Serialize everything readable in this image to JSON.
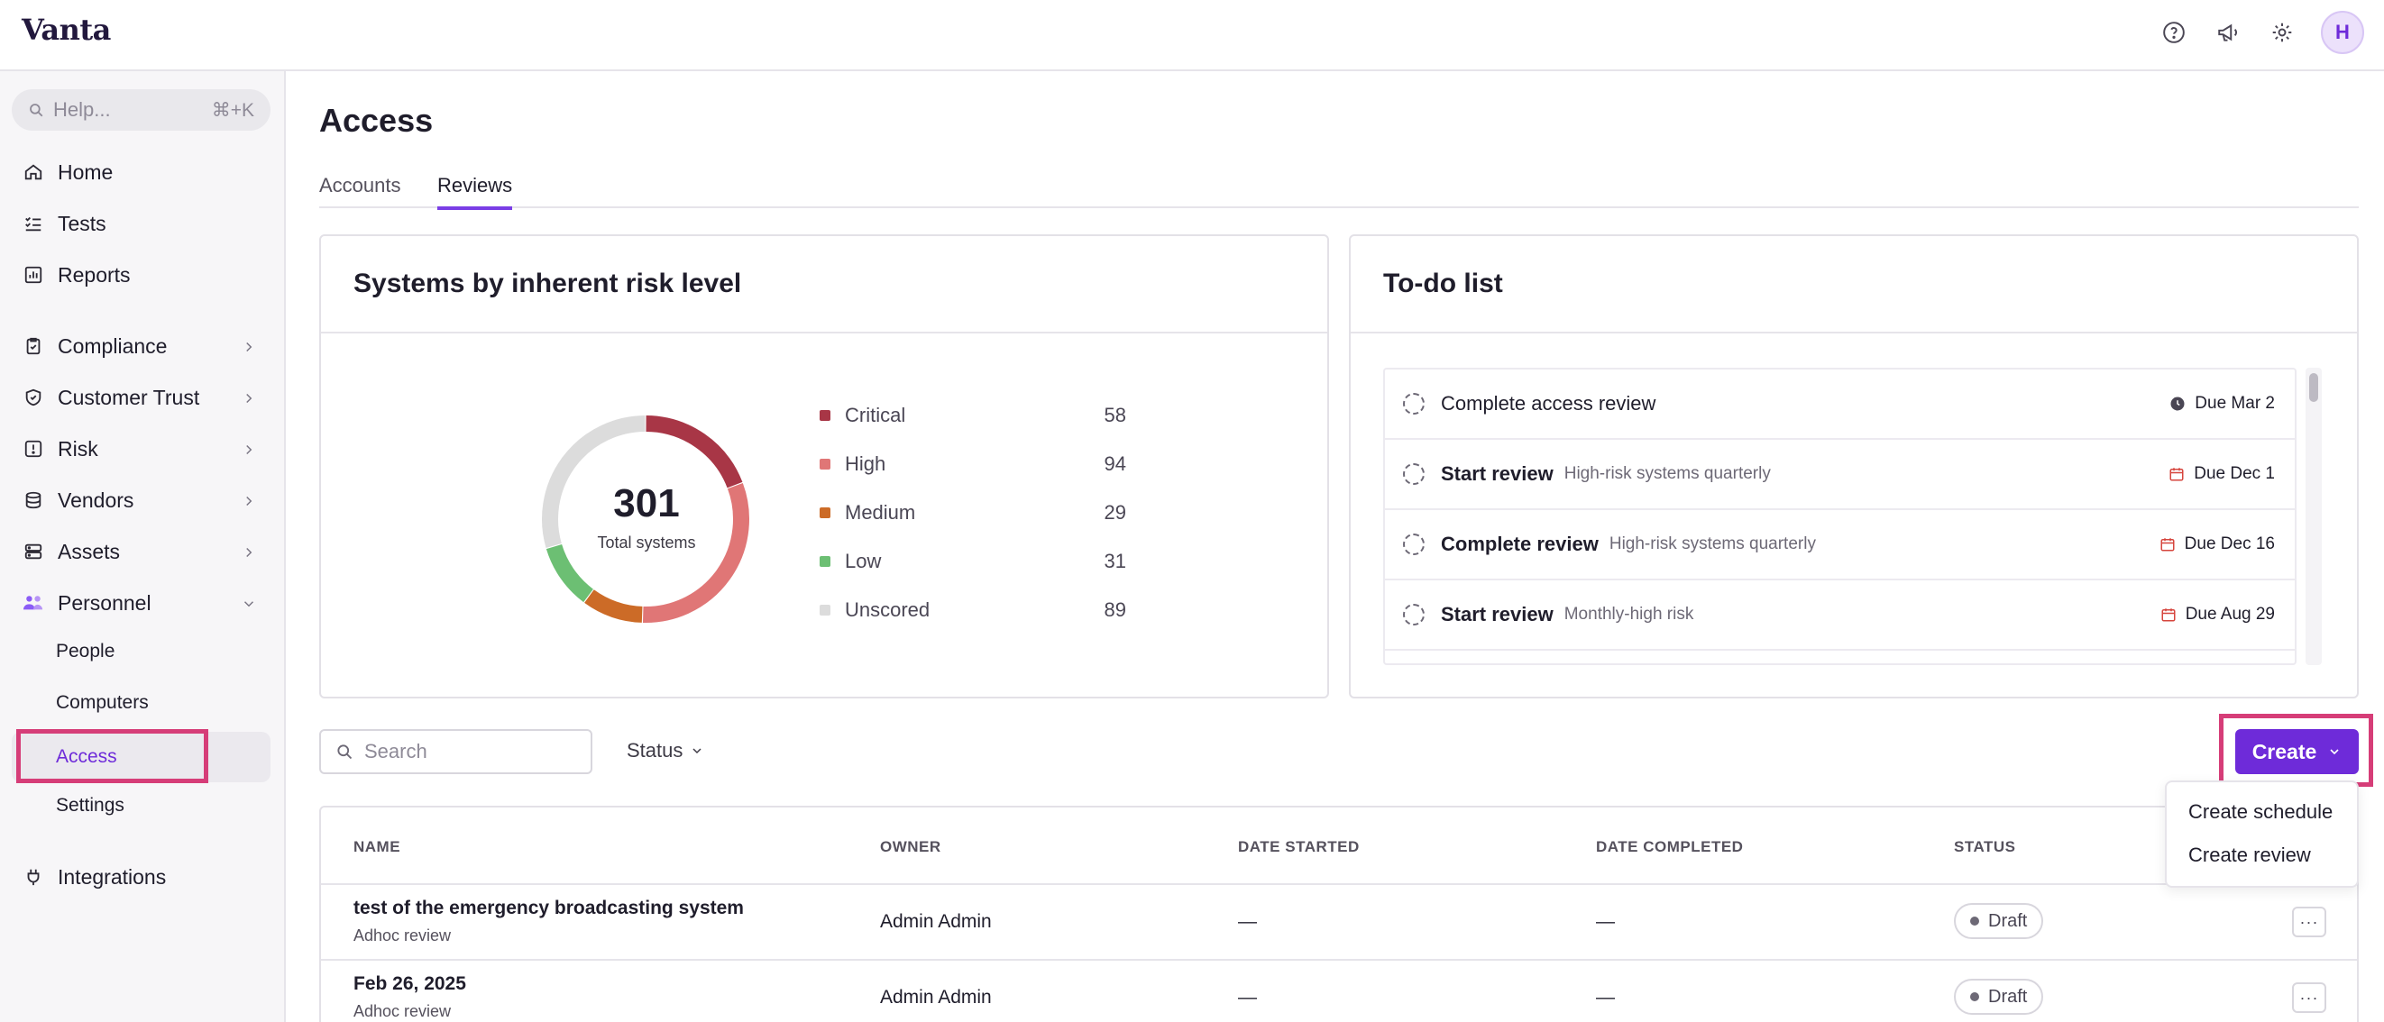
{
  "app": {
    "logo": "Vanta"
  },
  "topbar": {
    "avatar_initial": "H",
    "icons": [
      "help-icon",
      "megaphone-icon",
      "gear-icon"
    ]
  },
  "sidebar": {
    "search_placeholder": "Help...",
    "search_shortcut": "⌘+K",
    "items": [
      {
        "label": "Home",
        "icon": "home-icon"
      },
      {
        "label": "Tests",
        "icon": "checklist-icon"
      },
      {
        "label": "Reports",
        "icon": "chart-icon"
      },
      {
        "label": "Compliance",
        "icon": "clipboard-icon"
      },
      {
        "label": "Customer Trust",
        "icon": "shield-icon"
      },
      {
        "label": "Risk",
        "icon": "alert-icon"
      },
      {
        "label": "Vendors",
        "icon": "database-icon"
      },
      {
        "label": "Assets",
        "icon": "server-icon"
      },
      {
        "label": "Personnel",
        "icon": "people-icon"
      },
      {
        "label": "Integrations",
        "icon": "plug-icon"
      }
    ],
    "personnel_sub": [
      "People",
      "Computers",
      "Access",
      "Settings"
    ],
    "active_item": "Access"
  },
  "main": {
    "title": "Access",
    "tabs": [
      "Accounts",
      "Reviews"
    ],
    "active_tab": "Reviews"
  },
  "risk_card": {
    "title": "Systems by inherent risk level",
    "total": "301",
    "total_label": "Total systems"
  },
  "chart_data": {
    "type": "pie",
    "categories": [
      "Critical",
      "High",
      "Medium",
      "Low",
      "Unscored"
    ],
    "values": [
      58,
      94,
      29,
      31,
      89
    ],
    "colors": [
      "#a83646",
      "#e07676",
      "#cc6b27",
      "#6cbf73",
      "#dcdcdc"
    ]
  },
  "todo": {
    "title": "To-do list",
    "items": [
      {
        "title": "Complete access review",
        "sub": "",
        "due": "Due Mar 2",
        "icon": "clock-icon"
      },
      {
        "title": "Start review",
        "sub": "High-risk systems quarterly",
        "due": "Due Dec 1",
        "icon": "calendar-icon"
      },
      {
        "title": "Complete review",
        "sub": "High-risk systems quarterly",
        "due": "Due Dec 16",
        "icon": "calendar-icon"
      },
      {
        "title": "Start review",
        "sub": "Monthly-high risk",
        "due": "Due Aug 29",
        "icon": "calendar-icon"
      }
    ]
  },
  "filters": {
    "search_placeholder": "Search",
    "status_label": "Status"
  },
  "create": {
    "label": "Create",
    "options": [
      "Create schedule",
      "Create review"
    ]
  },
  "table": {
    "columns": [
      "NAME",
      "OWNER",
      "DATE STARTED",
      "DATE COMPLETED",
      "STATUS"
    ],
    "rows": [
      {
        "name": "test of the emergency broadcasting system",
        "type": "Adhoc review",
        "owner": "Admin Admin",
        "started": "—",
        "completed": "—",
        "status": "Draft"
      },
      {
        "name": "Feb 26, 2025",
        "type": "Adhoc review",
        "owner": "Admin Admin",
        "started": "—",
        "completed": "—",
        "status": "Draft"
      }
    ]
  },
  "colors": {
    "accent": "#6e2bd9",
    "highlight": "#d63d78"
  }
}
